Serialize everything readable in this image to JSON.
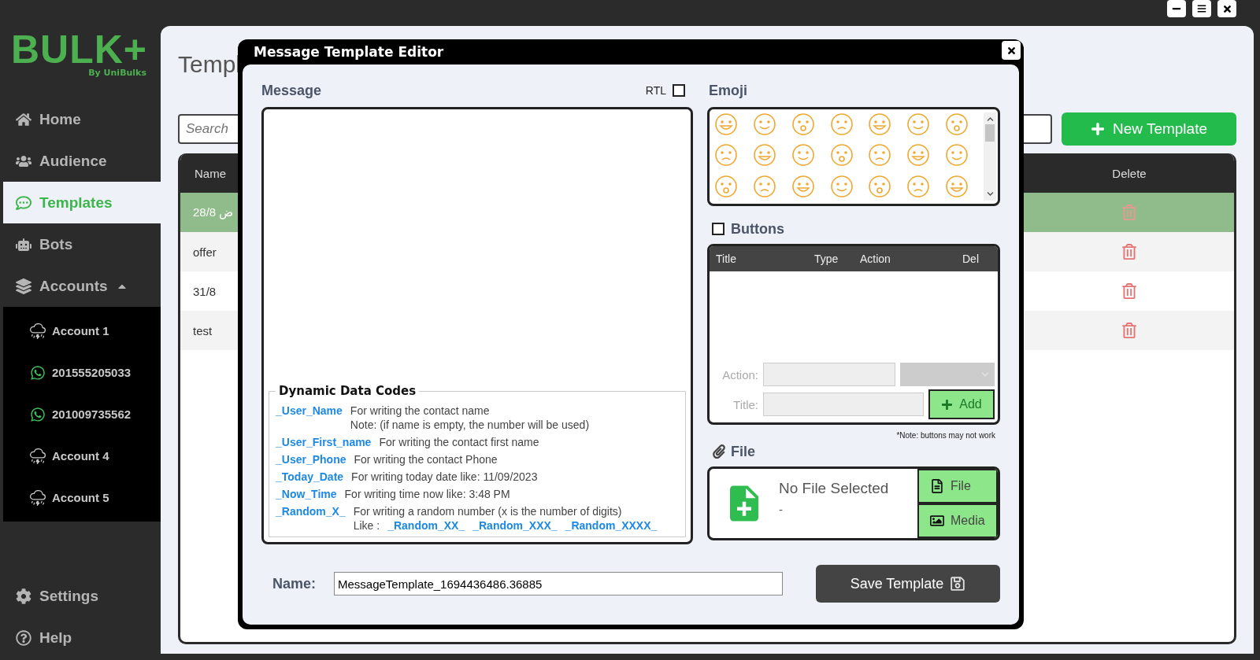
{
  "sidebar": {
    "logo": {
      "wordmark": "BULK+",
      "byline": "By UniBulks"
    },
    "items": [
      {
        "label": "Home",
        "selected": false
      },
      {
        "label": "Audience",
        "selected": false
      },
      {
        "label": "Templates",
        "selected": true
      },
      {
        "label": "Bots",
        "selected": false
      },
      {
        "label": "Accounts",
        "selected": false,
        "expanded": true,
        "children": [
          {
            "label": "Account 1",
            "kind": "cloud"
          },
          {
            "label": "201555205033",
            "kind": "whatsapp"
          },
          {
            "label": "201009735562",
            "kind": "whatsapp"
          },
          {
            "label": "Account 4",
            "kind": "cloud"
          },
          {
            "label": "Account 5",
            "kind": "cloud"
          }
        ]
      }
    ],
    "footer_items": [
      {
        "label": "Settings"
      },
      {
        "label": "Help"
      }
    ]
  },
  "templates_page": {
    "title": "Templ",
    "search": {
      "placeholder": "Search"
    },
    "new_template_button": "New Template",
    "table": {
      "columns": [
        "Name",
        "Delete"
      ],
      "rows": [
        {
          "name": "28/8 ض",
          "selected": true
        },
        {
          "name": "offer",
          "selected": false
        },
        {
          "name": "31/8",
          "selected": false
        },
        {
          "name": "test",
          "selected": false
        }
      ]
    }
  },
  "dialog": {
    "title": "Message Template Editor",
    "message": {
      "label": "Message",
      "rtl_label": "RTL",
      "rtl_checked": false
    },
    "dynamic_codes": {
      "title": "Dynamic Data Codes",
      "entries": [
        {
          "code": "_User_Name",
          "description": "For writing the contact name",
          "note": "Note: (if name is empty, the number will be used)"
        },
        {
          "code": "_User_First_name",
          "description": "For writing the contact first name"
        },
        {
          "code": "_User_Phone",
          "description": "For writing the contact Phone"
        },
        {
          "code": "_Today_Date",
          "description": "For writing today date like:  11/09/2023"
        },
        {
          "code": "_Now_Time",
          "description": "For writing time now like:  3:48 PM"
        },
        {
          "code": "_Random_X_",
          "description": "For writing a random number (x is the number of digits)",
          "like_label": "Like :",
          "examples": [
            "_Random_XX_",
            "_Random_XXX_",
            "_Random_XXXX_"
          ]
        }
      ]
    },
    "emoji": {
      "label": "Emoji"
    },
    "buttons": {
      "label": "Buttons",
      "checked": false,
      "columns": [
        "Title",
        "Type",
        "Action",
        "Del"
      ],
      "action_label": "Action:",
      "action_field_disabled": true,
      "type_select_disabled": true,
      "title_label": "Title:",
      "title_field_disabled": true,
      "add_button": "Add",
      "note": "*Note: buttons may not work"
    },
    "file": {
      "label": "File",
      "status": "No File Selected",
      "detail": "-",
      "file_button": "File",
      "media_button": "Media"
    },
    "name": {
      "label": "Name:",
      "value": "MessageTemplate_1694436486.36885"
    },
    "save_button": "Save Template"
  }
}
